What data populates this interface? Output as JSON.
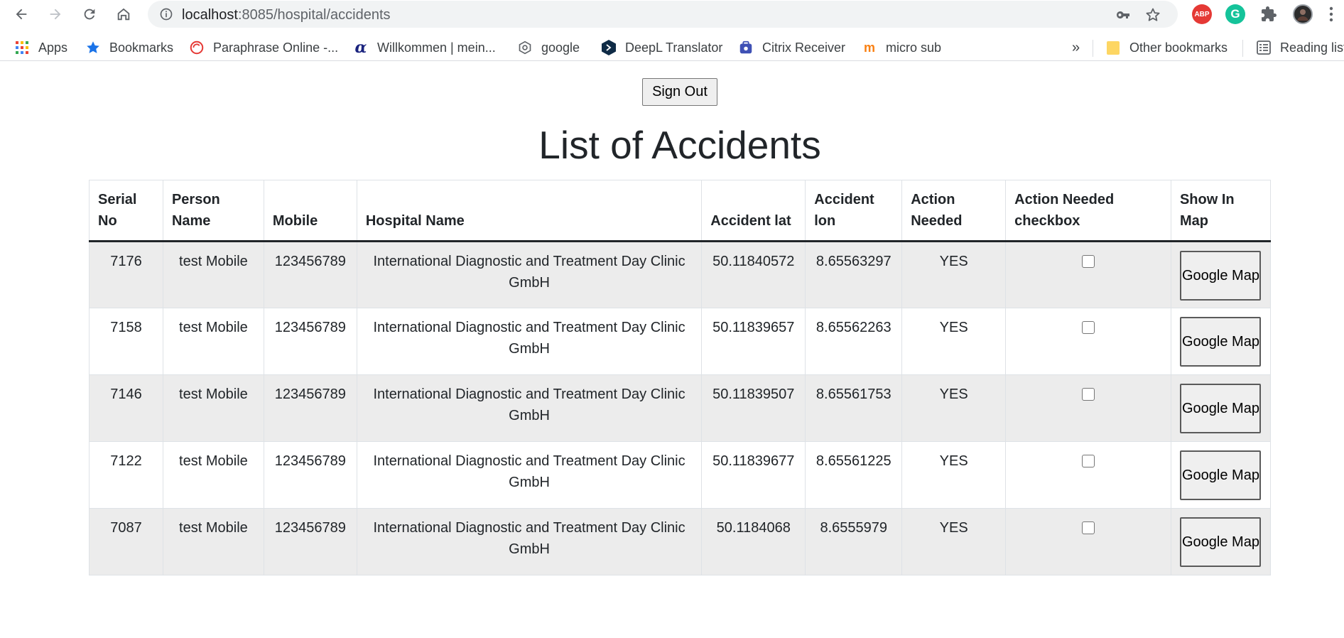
{
  "browser": {
    "url_host": "localhost",
    "url_path": ":8085/hospital/accidents"
  },
  "bookmarks": {
    "items": [
      {
        "label": "Apps",
        "icon": "apps-grid-icon"
      },
      {
        "label": "Bookmarks",
        "icon": "star-icon"
      },
      {
        "label": "Paraphrase Online -...",
        "icon": "paraphrase-icon"
      },
      {
        "label": "Willkommen | mein...",
        "icon": "alpha-icon"
      },
      {
        "label": "google",
        "icon": "google-icon"
      },
      {
        "label": "DeepL Translator",
        "icon": "deepl-icon"
      },
      {
        "label": "Citrix Receiver",
        "icon": "citrix-icon"
      },
      {
        "label": "micro sub",
        "icon": "moodle-icon"
      }
    ],
    "overflow": "»",
    "other": "Other bookmarks",
    "reading": "Reading list"
  },
  "extensions": {
    "abp": "ABP",
    "grammarly": "G"
  },
  "page": {
    "signout_label": "Sign Out",
    "title": "List of Accidents"
  },
  "table": {
    "headers": {
      "serial": "Serial No",
      "person": "Person Name",
      "mobile": "Mobile",
      "hospital": "Hospital Name",
      "lat": "Accident lat",
      "lon": "Accident lon",
      "action": "Action Needed",
      "checkbox": "Action Needed checkbox",
      "map": "Show In Map"
    },
    "rows": [
      {
        "serial": "7176",
        "person": "test Mobile",
        "mobile": "123456789",
        "hospital": "International Diagnostic and Treatment Day Clinic GmbH",
        "lat": "50.11840572",
        "lon": "8.65563297",
        "action": "YES",
        "checked": false,
        "map_label": "Google Map"
      },
      {
        "serial": "7158",
        "person": "test Mobile",
        "mobile": "123456789",
        "hospital": "International Diagnostic and Treatment Day Clinic GmbH",
        "lat": "50.11839657",
        "lon": "8.65562263",
        "action": "YES",
        "checked": false,
        "map_label": "Google Map"
      },
      {
        "serial": "7146",
        "person": "test Mobile",
        "mobile": "123456789",
        "hospital": "International Diagnostic and Treatment Day Clinic GmbH",
        "lat": "50.11839507",
        "lon": "8.65561753",
        "action": "YES",
        "checked": false,
        "map_label": "Google Map"
      },
      {
        "serial": "7122",
        "person": "test Mobile",
        "mobile": "123456789",
        "hospital": "International Diagnostic and Treatment Day Clinic GmbH",
        "lat": "50.11839677",
        "lon": "8.65561225",
        "action": "YES",
        "checked": false,
        "map_label": "Google Map"
      },
      {
        "serial": "7087",
        "person": "test Mobile",
        "mobile": "123456789",
        "hospital": "International Diagnostic and Treatment Day Clinic GmbH",
        "lat": "50.1184068",
        "lon": "8.6555979",
        "action": "YES",
        "checked": false,
        "map_label": "Google Map"
      }
    ]
  }
}
